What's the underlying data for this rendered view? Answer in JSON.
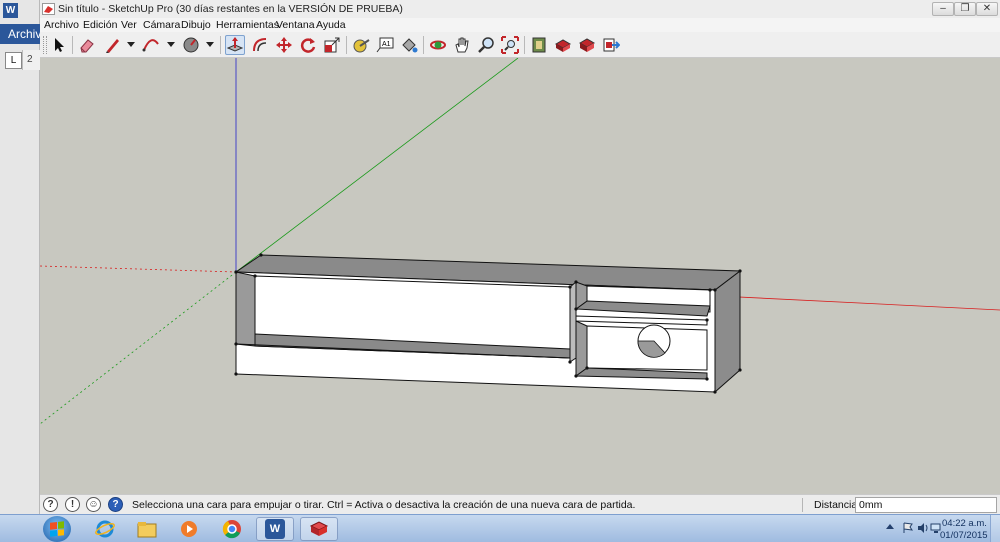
{
  "background_word": {
    "app_letter": "W",
    "archivo_tab": "Archiv",
    "ruler_corner": "L",
    "ruler_number": "2"
  },
  "window": {
    "title": "Sin título - SketchUp Pro (30 días restantes en la VERSIÓN DE PRUEBA)",
    "minimize": "–",
    "restore": "❐",
    "close": "✕"
  },
  "menu": [
    "Archivo",
    "Edición",
    "Ver",
    "Cámara",
    "Dibujo",
    "Herramientas",
    "Ventana",
    "Ayuda"
  ],
  "toolbar": {
    "tools": [
      "select-tool",
      "eraser-tool",
      "pencil-line-tool",
      "arc-tool",
      "shape-tool",
      "push-pull-tool",
      "offset-tool",
      "move-tool",
      "rotate-tool",
      "scale-tool",
      "tape-measure-tool",
      "text-tool",
      "paint-bucket-tool",
      "orbit-tool",
      "pan-tool",
      "zoom-tool",
      "zoom-extents-tool",
      "warehouse-tool",
      "extension-tool",
      "share-model-tool",
      "send-to-layout-tool"
    ],
    "active_tool": "push-pull-tool",
    "text_tool_label": "A1"
  },
  "statusbar": {
    "icon_geo": "?",
    "icon_info": "!",
    "icon_user": "☺",
    "icon_help": "?",
    "message": "Selecciona una cara para empujar o tirar. Ctrl = Activa o desactiva la creación de una nueva cara de partida.",
    "measurement_label": "Distancia",
    "measurement_value": "0mm"
  },
  "taskbar": {
    "apps": [
      "windows-explorer",
      "internet-explorer",
      "file-explorer",
      "media-player",
      "chrome",
      "word",
      "sketchup"
    ],
    "open_apps": [
      "word",
      "sketchup"
    ],
    "word_letter": "W",
    "time": "04:22 a.m.",
    "date": "01/07/2015"
  },
  "colors": {
    "axis_red": "#d81e1e",
    "axis_green": "#1a9a1a",
    "axis_blue": "#2424c8",
    "viewport_bg": "#c8c8c0",
    "model_light_face": "#ffffff",
    "model_dark_face": "#8c8c8c",
    "taskbar_accent": "#2b579a"
  }
}
